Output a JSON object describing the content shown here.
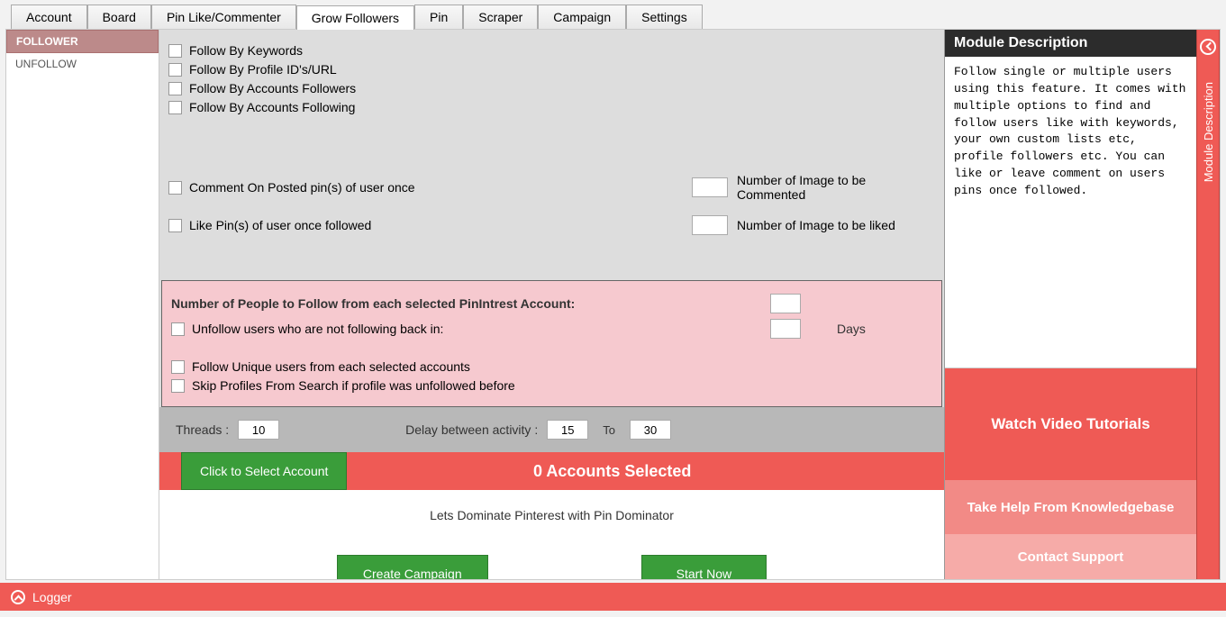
{
  "tabs": [
    "Account",
    "Board",
    "Pin Like/Commenter",
    "Grow Followers",
    "Pin",
    "Scraper",
    "Campaign",
    "Settings"
  ],
  "active_tab_index": 3,
  "sidebar": {
    "items": [
      "FOLLOWER",
      "UNFOLLOW"
    ],
    "active_index": 0
  },
  "follow_options": {
    "by_keywords": "Follow By Keywords",
    "by_profile": "Follow By Profile ID's/URL",
    "by_followers": "Follow By Accounts Followers",
    "by_following": "Follow By Accounts Following"
  },
  "secondary_options": {
    "comment_label": "Comment On Posted pin(s) of user once",
    "like_label": "Like Pin(s) of user once followed",
    "img_comment_label": "Number of Image to be Commented",
    "img_like_label": "Number of Image to be liked",
    "img_comment_value": "",
    "img_like_value": ""
  },
  "pink_panel": {
    "people_label": "Number of People to Follow from each selected PinIntrest Account:",
    "people_value": "",
    "unfollow_label": "Unfollow users who are not following back in:",
    "unfollow_value": "",
    "days_label": "Days",
    "unique_label": "Follow Unique users from each selected accounts",
    "skip_label": "Skip Profiles From Search if profile was unfollowed before"
  },
  "gray_bar": {
    "threads_label": "Threads :",
    "threads_value": "10",
    "delay_label": "Delay between activity :",
    "delay_from": "15",
    "delay_to_label": "To",
    "delay_to": "30"
  },
  "account_bar": {
    "select_button": "Click to Select Account",
    "status": "0 Accounts Selected"
  },
  "action_area": {
    "tagline": "Lets Dominate Pinterest with Pin Dominator",
    "create_campaign": "Create Campaign",
    "start_now": "Start Now"
  },
  "module_desc": {
    "title": "Module Description",
    "body": "Follow single or multiple users using this feature. It comes with multiple options to find and follow users like with keywords, your own custom lists etc, profile followers etc. You can like or leave comment on users pins once followed.",
    "ribbon_label": "Module Description"
  },
  "right_buttons": {
    "watch": "Watch Video Tutorials",
    "kb": "Take Help From Knowledgebase",
    "cs": "Contact Support"
  },
  "logger": {
    "label": "Logger"
  }
}
